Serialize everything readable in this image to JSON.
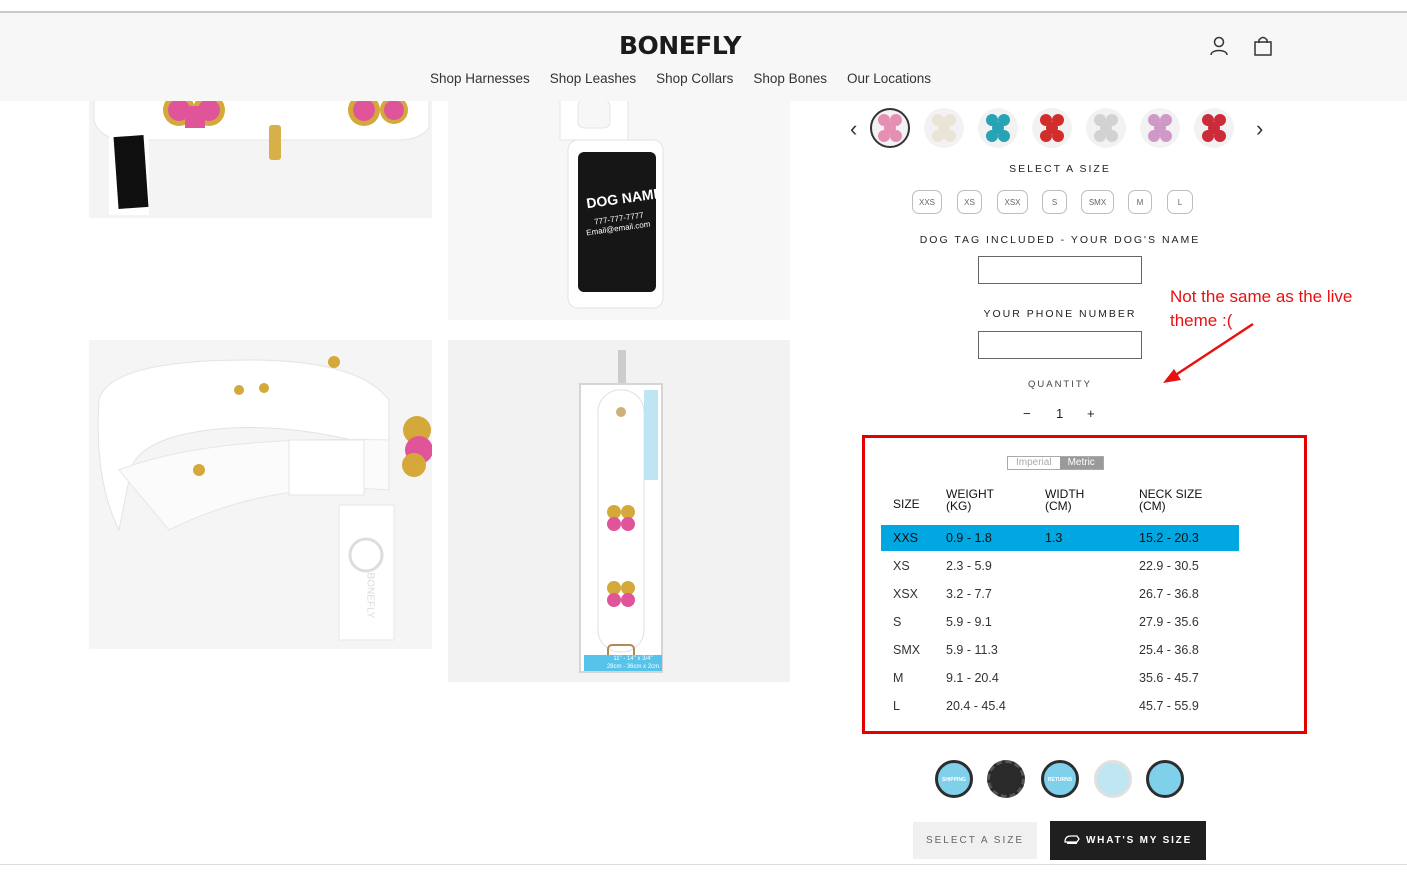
{
  "header": {
    "logo": "BONEFLY",
    "nav": [
      "Shop Harnesses",
      "Shop Leashes",
      "Shop Collars",
      "Shop Bones",
      "Our Locations"
    ],
    "account_icon": "user-icon",
    "cart_icon": "bag-icon"
  },
  "product": {
    "tag_text": {
      "name": "DOG NAME",
      "phone": "777-777-7777",
      "email": "Email@email.com"
    },
    "package_label": {
      "line1": "11\" - 14\" x 3/4\"",
      "line2": "28cm - 36cm x 2cm"
    },
    "collar_brand": "BONEFLY",
    "swatch_colors": [
      "#e58fb2",
      "#e9e4d6",
      "#26a3b4",
      "#d22d2d",
      "#d2d2d2",
      "#cf99c7",
      "#cc2b3a"
    ],
    "select_size_label": "SELECT A SIZE",
    "sizes": [
      "XXS",
      "XS",
      "XSX",
      "S",
      "SMX",
      "M",
      "L"
    ],
    "dog_tag_label": "DOG TAG INCLUDED - YOUR DOG'S NAME",
    "phone_label": "YOUR PHONE NUMBER",
    "quantity_label": "QUANTITY",
    "quantity": {
      "minus": "−",
      "value": "1",
      "plus": "+"
    }
  },
  "size_chart": {
    "toggle": {
      "imperial": "Imperial",
      "metric": "Metric"
    },
    "headers": {
      "size": "SIZE",
      "weight": "WEIGHT (KG)",
      "width": "WIDTH (CM)",
      "neck": "NECK SIZE (CM)"
    },
    "rows": [
      {
        "size": "XXS",
        "weight": "0.9 - 1.8",
        "width": "1.3",
        "neck": "15.2 - 20.3"
      },
      {
        "size": "XS",
        "weight": "2.3 - 5.9",
        "width": "",
        "neck": "22.9 - 30.5"
      },
      {
        "size": "XSX",
        "weight": "3.2 - 7.7",
        "width": "",
        "neck": "26.7 - 36.8"
      },
      {
        "size": "S",
        "weight": "5.9 - 9.1",
        "width": "",
        "neck": "27.9 - 35.6"
      },
      {
        "size": "SMX",
        "weight": "5.9 - 11.3",
        "width": "",
        "neck": "25.4 - 36.8"
      },
      {
        "size": "M",
        "weight": "9.1 - 20.4",
        "width": "",
        "neck": "35.6 - 45.7"
      },
      {
        "size": "L",
        "weight": "20.4 - 45.4",
        "width": "",
        "neck": "45.7 - 55.9"
      }
    ],
    "highlight_color": "#00a7e1"
  },
  "badges": [
    "free-shipping-badge",
    "guarantee-seal",
    "free-returns-badge",
    "environmentally-friendly-badge",
    "quality-seal"
  ],
  "badge_texts": {
    "shipping": "SHIPPING",
    "returns": "RETURNS"
  },
  "buttons": {
    "select_size": "SELECT A SIZE",
    "whats_my_size": "WHAT'S MY SIZE"
  },
  "annotation": {
    "line1": "Not the same as the live",
    "line2": "theme :(",
    "color": "#e81010"
  }
}
